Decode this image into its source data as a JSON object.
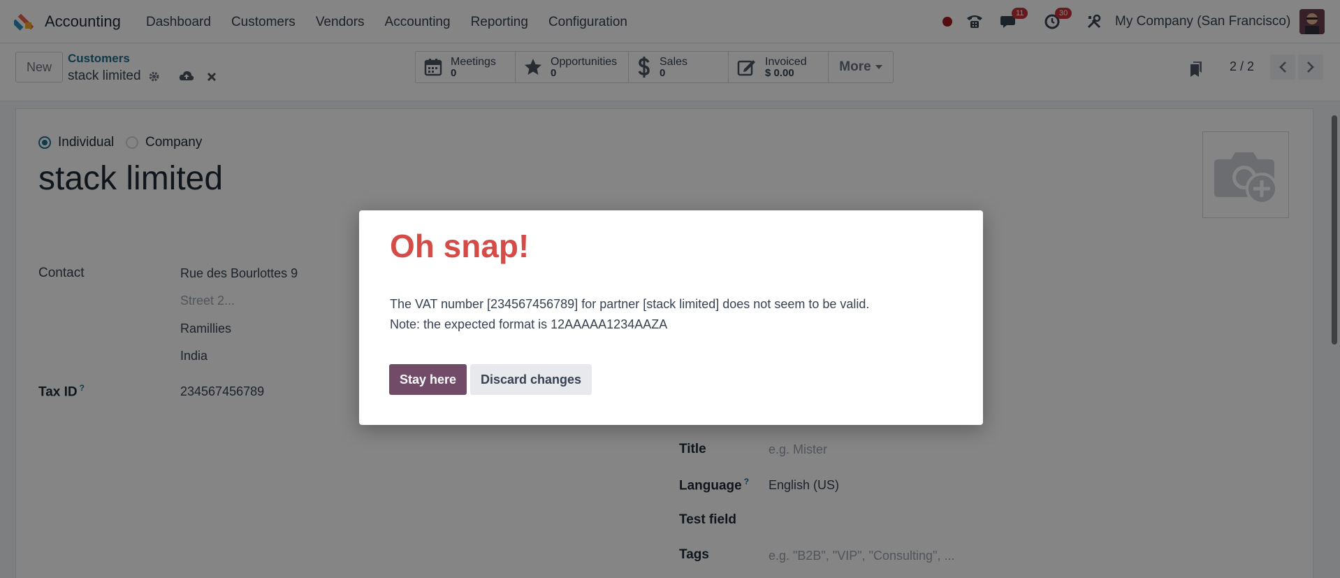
{
  "app": {
    "name": "Accounting"
  },
  "menu": [
    "Dashboard",
    "Customers",
    "Vendors",
    "Accounting",
    "Reporting",
    "Configuration"
  ],
  "systray": {
    "messages_count": "11",
    "activities_count": "30",
    "company": "My Company (San Francisco)"
  },
  "control": {
    "new_label": "New",
    "breadcrumb_parent": "Customers",
    "breadcrumb_current": "stack limited",
    "smart_buttons": [
      {
        "label": "Meetings",
        "value": "0",
        "icon": "calendar-icon"
      },
      {
        "label": "Opportunities",
        "value": "0",
        "icon": "star-icon"
      },
      {
        "label": "Sales",
        "value": "0",
        "icon": "dollar-icon"
      },
      {
        "label": "Invoiced",
        "value": "$ 0.00",
        "icon": "edit-icon"
      }
    ],
    "more_label": "More",
    "pager": "2 / 2"
  },
  "form": {
    "type_individual": "Individual",
    "type_company": "Company",
    "name": "stack limited",
    "contact_label": "Contact",
    "street": "Rue des Bourlottes 9",
    "street2_placeholder": "Street 2...",
    "city": "Ramillies",
    "country": "India",
    "tax_label": "Tax ID",
    "tax_value": "234567456789",
    "title_label": "Title",
    "title_placeholder": "e.g. Mister",
    "language_label": "Language",
    "language_value": "English (US)",
    "test_field_label": "Test field",
    "tags_label": "Tags",
    "tags_placeholder": "e.g. \"B2B\", \"VIP\", \"Consulting\", ...",
    "help_mark": "?"
  },
  "dialog": {
    "title": "Oh snap!",
    "line1": "The VAT number [234567456789] for partner [stack limited] does not seem to be valid.",
    "line2": "Note: the expected format is 12AAAAA1234AAZA",
    "stay_label": "Stay here",
    "discard_label": "Discard changes"
  },
  "colors": {
    "brand": "#714b67",
    "error_title": "#d44c47",
    "link": "#1d6d8a",
    "badge": "#c2343a"
  }
}
